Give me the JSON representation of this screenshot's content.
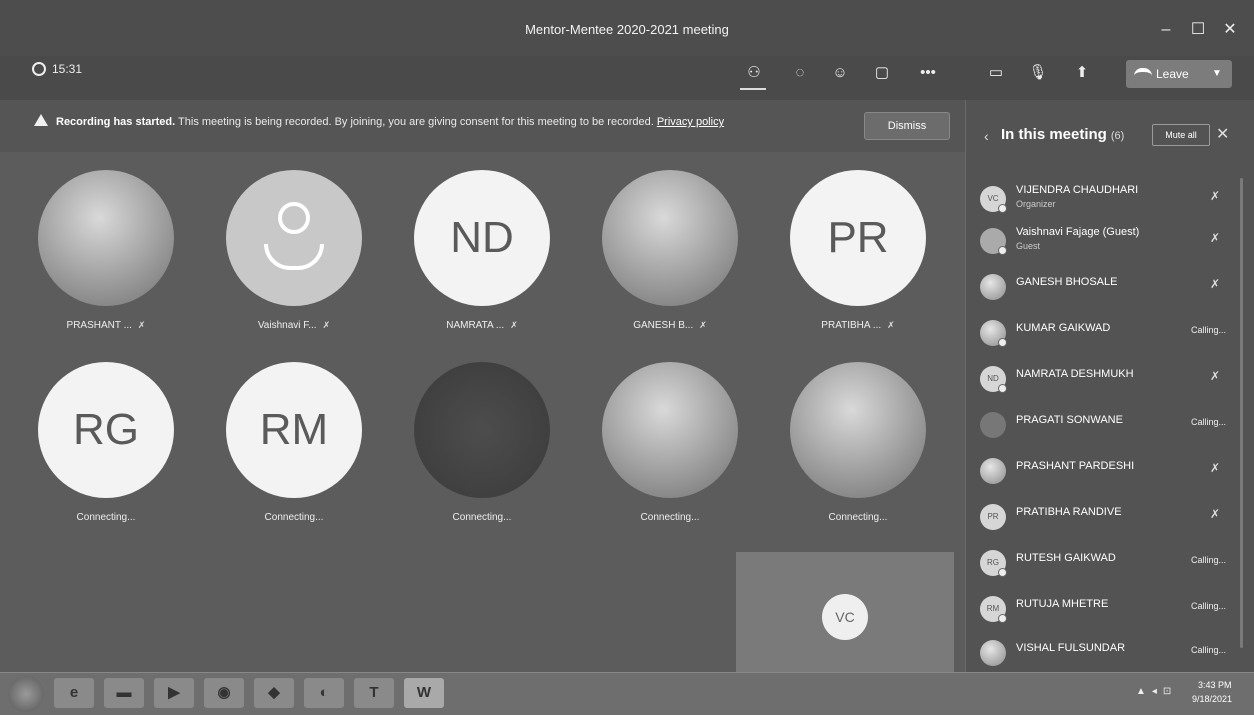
{
  "window": {
    "title": "Mentor-Mentee 2020-2021 meeting",
    "minimize": "–",
    "maximize": "☐",
    "close": "✕"
  },
  "toolbar": {
    "timer": "15:31",
    "leave_label": "Leave"
  },
  "banner": {
    "bold_text": "Recording has started.",
    "text": " This meeting is being recorded. By joining, you are giving consent for this meeting to be recorded. ",
    "link_text": "Privacy policy",
    "dismiss_label": "Dismiss"
  },
  "grid": {
    "row1": [
      {
        "label": "PRASHANT ..."
      },
      {
        "label": "Vaishnavi F..."
      },
      {
        "label": "NAMRATA ...",
        "initials": "ND"
      },
      {
        "label": "GANESH B..."
      },
      {
        "label": "PRATIBHA ...",
        "initials": "PR"
      }
    ],
    "row2": [
      {
        "label": "Connecting...",
        "initials": "RG"
      },
      {
        "label": "Connecting...",
        "initials": "RM"
      },
      {
        "label": "Connecting..."
      },
      {
        "label": "Connecting..."
      },
      {
        "label": "Connecting..."
      }
    ],
    "self_initials": "VC"
  },
  "panel": {
    "title": "In this meeting",
    "count": "(6)",
    "mute_all_label": "Mute all",
    "participants": [
      {
        "name": "VIJENDRA CHAUDHARI",
        "sub": "Organizer",
        "initials": "VC",
        "status": ""
      },
      {
        "name": "Vaishnavi Fajage (Guest)",
        "sub": "Guest",
        "initials": "",
        "status": ""
      },
      {
        "name": "GANESH BHOSALE",
        "sub": "",
        "initials": "",
        "status": ""
      },
      {
        "name": "KUMAR GAIKWAD",
        "sub": "",
        "initials": "",
        "status": "Calling..."
      },
      {
        "name": "NAMRATA DESHMUKH",
        "sub": "",
        "initials": "ND",
        "status": ""
      },
      {
        "name": "PRAGATI SONWANE",
        "sub": "",
        "initials": "",
        "status": "Calling..."
      },
      {
        "name": "PRASHANT PARDESHI",
        "sub": "",
        "initials": "",
        "status": ""
      },
      {
        "name": "PRATIBHA RANDIVE",
        "sub": "",
        "initials": "PR",
        "status": ""
      },
      {
        "name": "RUTESH GAIKWAD",
        "sub": "",
        "initials": "RG",
        "status": "Calling..."
      },
      {
        "name": "RUTUJA MHETRE",
        "sub": "",
        "initials": "RM",
        "status": "Calling..."
      },
      {
        "name": "VISHAL FULSUNDAR",
        "sub": "",
        "initials": "",
        "status": "Calling..."
      }
    ]
  },
  "taskbar": {
    "word_label": "W",
    "teams_label": "T",
    "time": "3:43 PM",
    "date": "9/18/2021"
  }
}
